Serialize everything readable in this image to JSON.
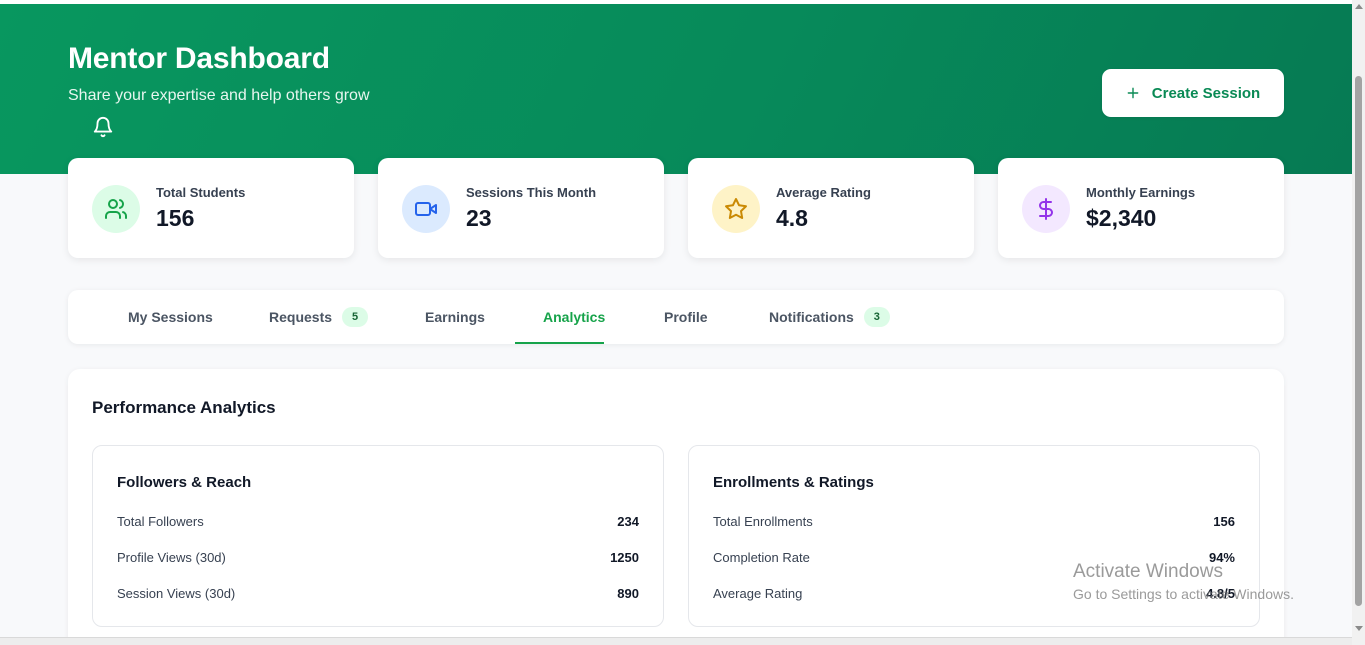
{
  "header": {
    "title": "Mentor Dashboard",
    "subtitle": "Share your expertise and help others grow",
    "create_button": "Create Session",
    "bell_icon": "bell-icon",
    "plus_icon": "plus-icon"
  },
  "stats": [
    {
      "label": "Total Students",
      "value": "156",
      "icon": "users-icon",
      "bg": "#dcfce7",
      "color": "#16a34a"
    },
    {
      "label": "Sessions This Month",
      "value": "23",
      "icon": "video-icon",
      "bg": "#dbeafe",
      "color": "#2563eb"
    },
    {
      "label": "Average Rating",
      "value": "4.8",
      "icon": "star-icon",
      "bg": "#fef3c7",
      "color": "#ca8a04"
    },
    {
      "label": "Monthly Earnings",
      "value": "$2,340",
      "icon": "dollar-icon",
      "bg": "#f3e8ff",
      "color": "#9333ea"
    }
  ],
  "tabs": [
    {
      "label": "My Sessions"
    },
    {
      "label": "Requests",
      "badge": "5"
    },
    {
      "label": "Earnings"
    },
    {
      "label": "Analytics",
      "active": true
    },
    {
      "label": "Profile"
    },
    {
      "label": "Notifications",
      "badge": "3"
    }
  ],
  "analytics": {
    "title": "Performance Analytics",
    "followers": {
      "title": "Followers & Reach",
      "rows": [
        {
          "label": "Total Followers",
          "value": "234"
        },
        {
          "label": "Profile Views (30d)",
          "value": "1250"
        },
        {
          "label": "Session Views (30d)",
          "value": "890"
        }
      ]
    },
    "enrollments": {
      "title": "Enrollments & Ratings",
      "rows": [
        {
          "label": "Total Enrollments",
          "value": "156"
        },
        {
          "label": "Completion Rate",
          "value": "94%"
        },
        {
          "label": "Average Rating",
          "value": "4.8/5"
        }
      ]
    }
  },
  "watermark": {
    "line1": "Activate Windows",
    "line2": "Go to Settings to activate Windows."
  },
  "colors": {
    "brand_green": "#08975f",
    "accent_green": "#16a34a"
  }
}
